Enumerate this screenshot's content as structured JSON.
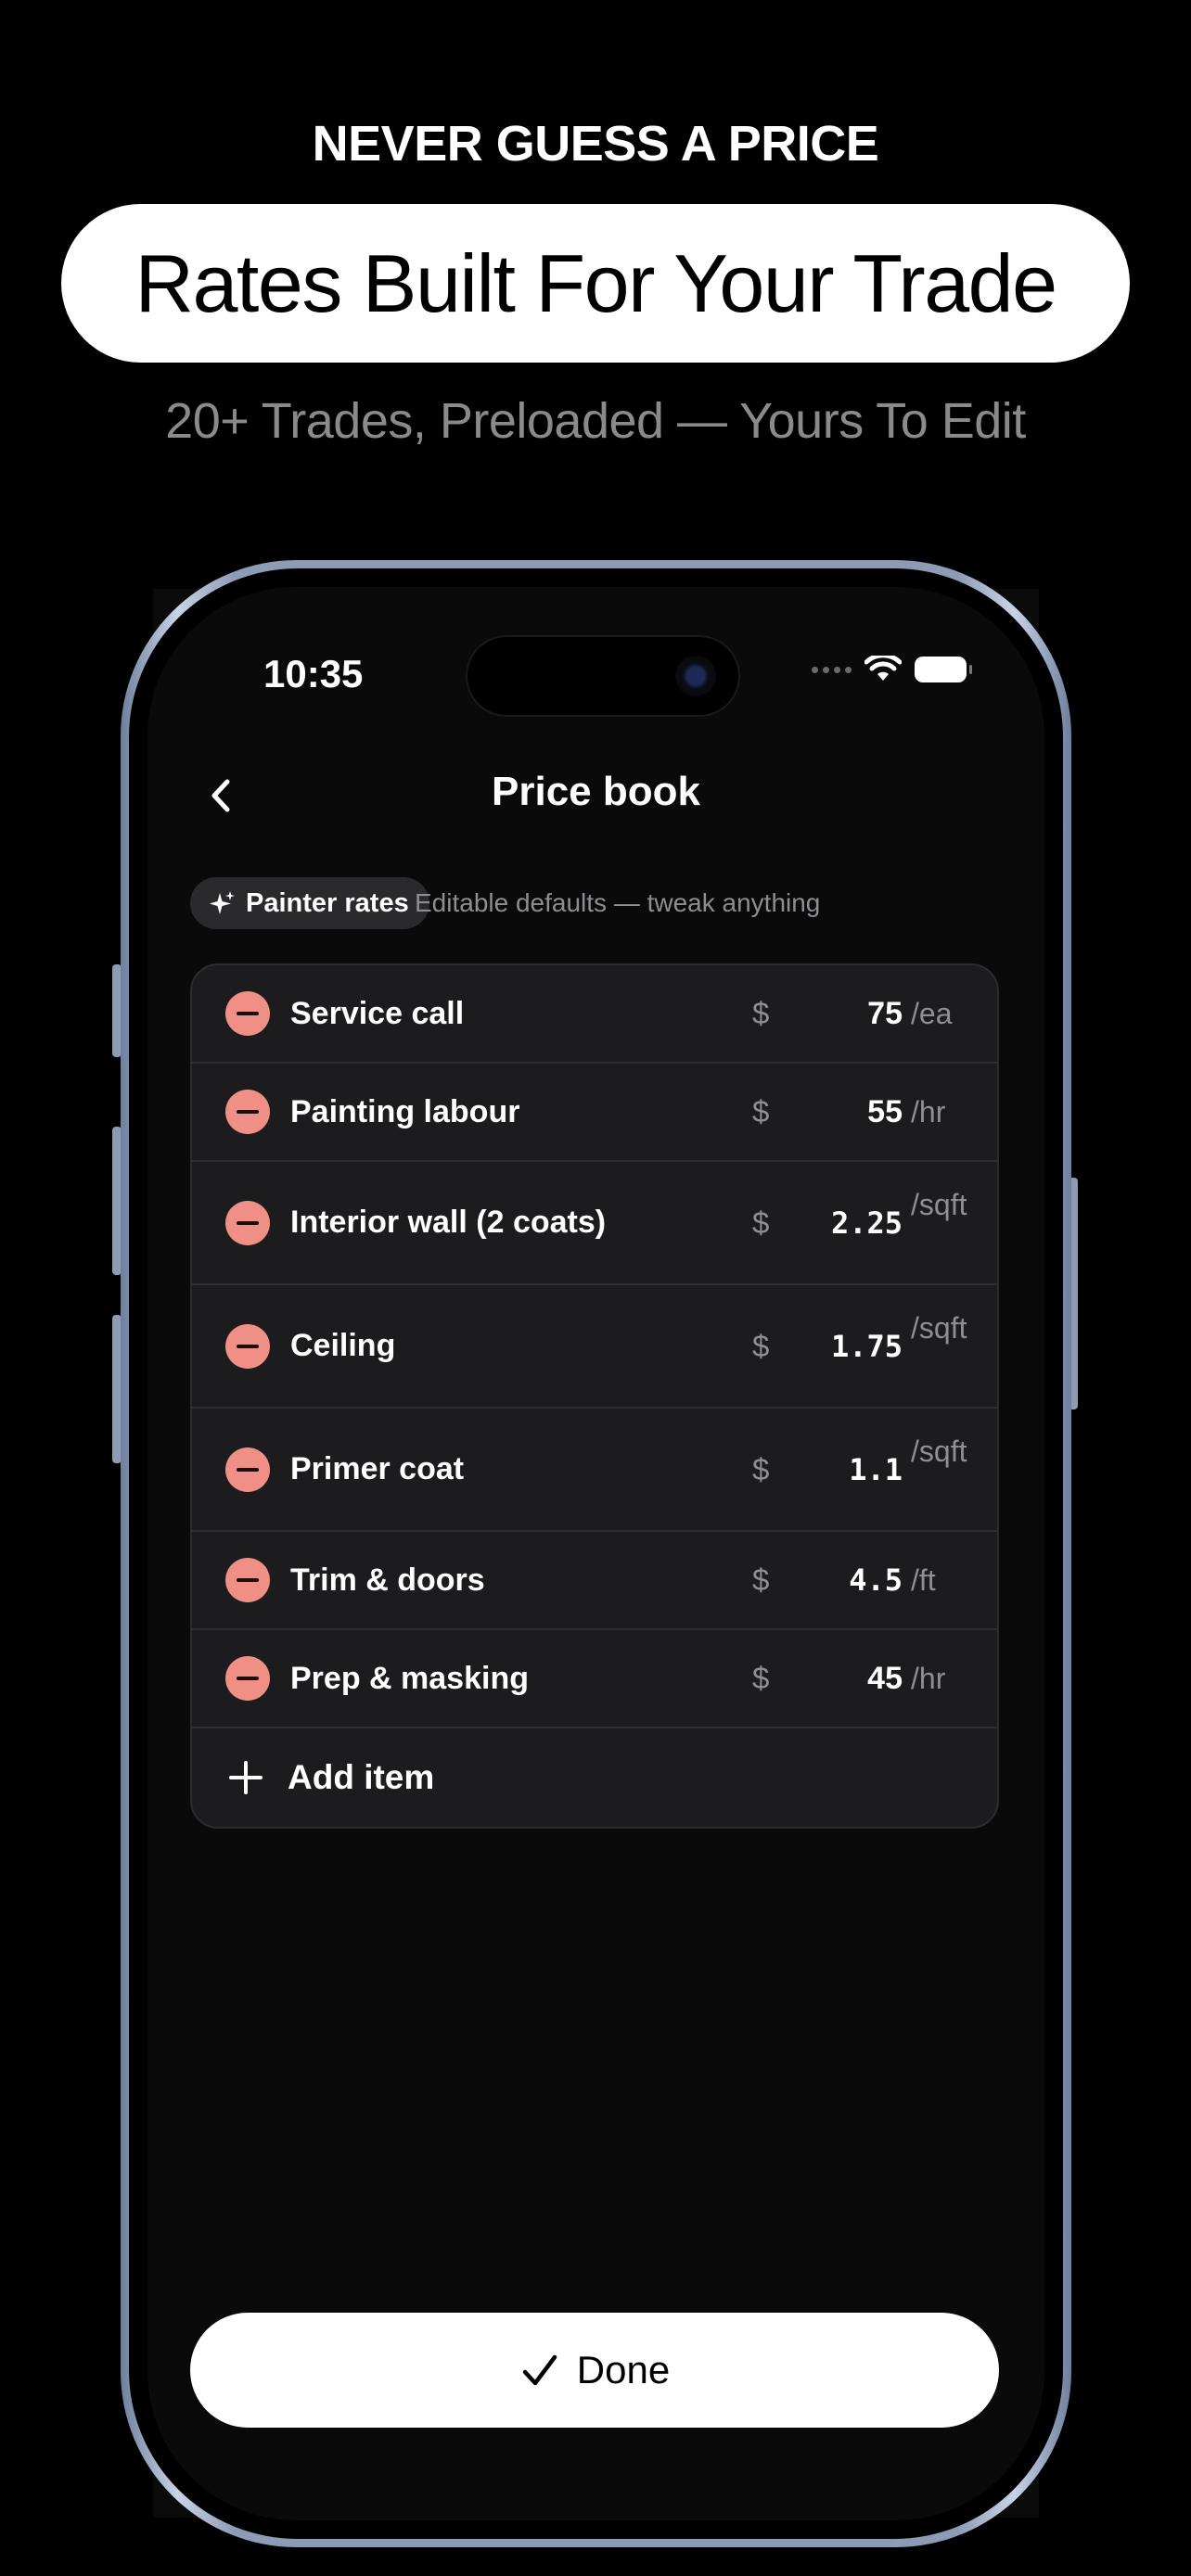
{
  "marketing": {
    "eyebrow": "NEVER GUESS A PRICE",
    "headline": "Rates Built For Your Trade",
    "subhead": "20+ Trades, Preloaded — Yours To Edit"
  },
  "status_bar": {
    "time": "10:35"
  },
  "nav": {
    "title": "Price book",
    "back_icon": "chevron-left-icon"
  },
  "preset": {
    "chip_label": "Painter rates",
    "chip_icon": "sparkle-icon",
    "caption": "Editable defaults — tweak anything"
  },
  "items": [
    {
      "name": "Service call",
      "currency": "$",
      "price": "75",
      "unit": "/ea",
      "mono": false,
      "stacked": false
    },
    {
      "name": "Painting labour",
      "currency": "$",
      "price": "55",
      "unit": "/hr",
      "mono": false,
      "stacked": false
    },
    {
      "name": "Interior wall (2 coats)",
      "currency": "$",
      "price": "2.25",
      "unit": "/sqft",
      "mono": true,
      "stacked": true
    },
    {
      "name": "Ceiling",
      "currency": "$",
      "price": "1.75",
      "unit": "/sqft",
      "mono": true,
      "stacked": true
    },
    {
      "name": "Primer coat",
      "currency": "$",
      "price": "1.1",
      "unit": "/sqft",
      "mono": true,
      "stacked": true
    },
    {
      "name": "Trim & doors",
      "currency": "$",
      "price": "4.5",
      "unit": "/ft",
      "mono": true,
      "stacked": false
    },
    {
      "name": "Prep & masking",
      "currency": "$",
      "price": "45",
      "unit": "/hr",
      "mono": false,
      "stacked": false
    }
  ],
  "add_item_label": "Add item",
  "done_label": "Done",
  "colors": {
    "background": "#000000",
    "remove_accent": "#ef8f86",
    "card": "#1c1c1e",
    "secondary_text": "#8e8e93"
  }
}
